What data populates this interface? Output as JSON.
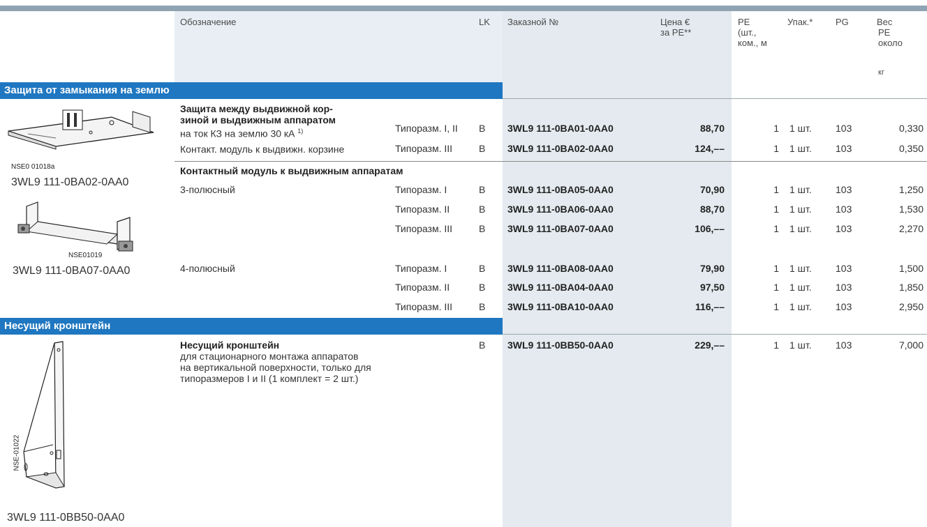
{
  "headers": {
    "designation": "Обозначение",
    "lk": "LK",
    "order_no": "Заказной №",
    "price_l1": "Цена €",
    "price_l2": "за PE**",
    "pe_l1": "PE",
    "pe_l2": "(шт.,",
    "pe_l3": "ком., м",
    "pack": "Упак.*",
    "pg": "PG",
    "weight_l1": "Вес",
    "weight_l2": "PE",
    "weight_l3": "около",
    "weight_unit": "кг"
  },
  "section1": {
    "title": "Защита от замыкания на землю",
    "group1": {
      "title_l1": "Защита между выдвижной кор-",
      "title_l2": "зиной и выдвижным аппаратом",
      "desc_l1": "на ток КЗ на землю 30 кА",
      "footnote": "1)",
      "desc_l2": "Контакт. модуль к выдвижн. корзине",
      "image_code": "NSE0 01018a",
      "image_caption": "3WL9 111-0BA02-0AA0",
      "rows": [
        {
          "size": "Типоразм. I, II",
          "lk": "B",
          "order": "3WL9 111-0BA01-0AA0",
          "price": "88,70",
          "pe": "1",
          "pack": "1 шт.",
          "pg": "103",
          "weight": "0,330"
        },
        {
          "size": "Типоразм. III",
          "lk": "B",
          "order": "3WL9 111-0BA02-0AA0",
          "price": "124,––",
          "pe": "1",
          "pack": "1 шт.",
          "pg": "103",
          "weight": "0,350"
        }
      ]
    },
    "group2": {
      "title": "Контактный модуль к выдвижным аппаратам",
      "image_code": "NSE01019",
      "image_caption": "3WL9 111-0BA07-0AA0",
      "poles3": "3-полюсный",
      "poles4": "4-полюсный",
      "rows3": [
        {
          "size": "Типоразм. I",
          "lk": "B",
          "order": "3WL9 111-0BA05-0AA0",
          "price": "70,90",
          "pe": "1",
          "pack": "1 шт.",
          "pg": "103",
          "weight": "1,250"
        },
        {
          "size": "Типоразм. II",
          "lk": "B",
          "order": "3WL9 111-0BA06-0AA0",
          "price": "88,70",
          "pe": "1",
          "pack": "1 шт.",
          "pg": "103",
          "weight": "1,530"
        },
        {
          "size": "Типоразм. III",
          "lk": "B",
          "order": "3WL9 111-0BA07-0AA0",
          "price": "106,––",
          "pe": "1",
          "pack": "1 шт.",
          "pg": "103",
          "weight": "2,270"
        }
      ],
      "rows4": [
        {
          "size": "Типоразм. I",
          "lk": "B",
          "order": "3WL9 111-0BA08-0AA0",
          "price": "79,90",
          "pe": "1",
          "pack": "1 шт.",
          "pg": "103",
          "weight": "1,500"
        },
        {
          "size": "Типоразм. II",
          "lk": "B",
          "order": "3WL9 111-0BA04-0AA0",
          "price": "97,50",
          "pe": "1",
          "pack": "1 шт.",
          "pg": "103",
          "weight": "1,850"
        },
        {
          "size": "Типоразм. III",
          "lk": "B",
          "order": "3WL9 111-0BA10-0AA0",
          "price": "116,––",
          "pe": "1",
          "pack": "1 шт.",
          "pg": "103",
          "weight": "2,950"
        }
      ]
    }
  },
  "section2": {
    "title": "Несущий кронштейн",
    "item_title": "Несущий кронштейн",
    "desc_l1": "для стационарного монтажа аппаратов",
    "desc_l2": "на вертикальной поверхности, только для",
    "desc_l3": "типоразмеров I и II (1 комплект = 2 шт.)",
    "image_code": "NSE-01022",
    "image_caption": "3WL9 111-0BB50-0AA0",
    "row": {
      "lk": "B",
      "order": "3WL9 111-0BB50-0AA0",
      "price": "229,––",
      "pe": "1",
      "pack": "1 шт.",
      "pg": "103",
      "weight": "7,000"
    }
  }
}
